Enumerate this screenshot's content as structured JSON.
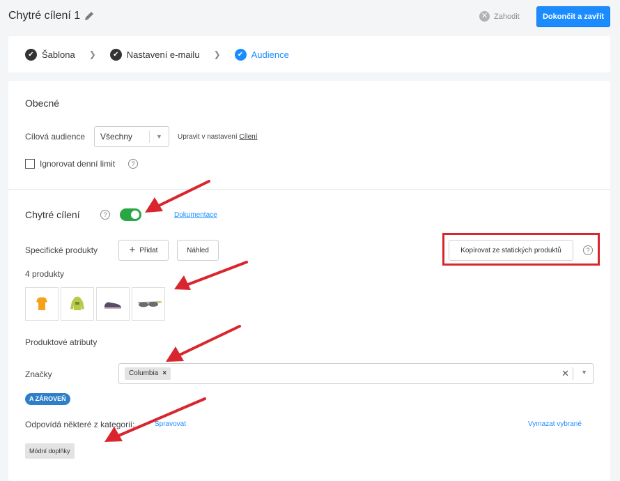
{
  "header": {
    "title": "Chytré cílení 1",
    "discard_label": "Zahodit",
    "finish_label": "Dokončit a zavřít"
  },
  "steps": [
    {
      "label": "Šablona",
      "state": "done"
    },
    {
      "label": "Nastavení e-mailu",
      "state": "done"
    },
    {
      "label": "Audience",
      "state": "active"
    }
  ],
  "general": {
    "heading": "Obecné",
    "audience_label": "Cílová audience",
    "audience_value": "Všechny",
    "edit_prefix": "Upravit v nastavení",
    "edit_link": "Cílení",
    "ignore_limit_label": "Ignorovat denní limit"
  },
  "smart": {
    "heading": "Chytré cílení",
    "toggle_on": true,
    "docs_link": "Dokumentace",
    "specific_label": "Specifické produkty",
    "add_label": "Přidat",
    "preview_label": "Náhled",
    "copy_label": "Kopírovat ze statických produktů",
    "count_label": "4 produkty",
    "products": [
      "tshirt-icon",
      "jacket-icon",
      "shoe-icon",
      "sunglasses-icon"
    ],
    "attributes_heading": "Produktové atributy",
    "brands_label": "Značky",
    "brand_tag": "Columbia",
    "and_pill": "A ZÁROVEŇ",
    "category_label": "Odpovídá některé z kategorií:",
    "manage_link": "Spravovat",
    "clear_link": "Vymazat vybrané",
    "category_chip": "Módní doplňky"
  },
  "colors": {
    "accent": "#1a8cff",
    "toggle": "#28a745",
    "annotation": "#d9252e"
  }
}
